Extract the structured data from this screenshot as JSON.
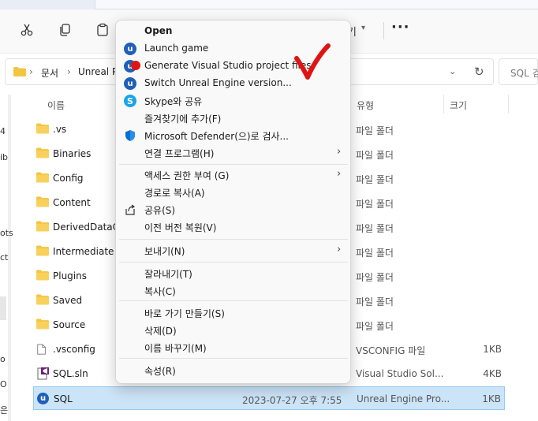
{
  "toolbar": {
    "items": [
      {
        "name": "cut-icon"
      },
      {
        "name": "copy-icon"
      },
      {
        "name": "paste-icon"
      }
    ],
    "view_label_fragment": "기",
    "more_label": "···"
  },
  "address": {
    "crumbs": [
      "문서",
      "Unreal P"
    ],
    "search_placeholder": "SQL 검"
  },
  "nav_fragments": [
    "4",
    "ib",
    "ots",
    "ct",
    "o",
    "O",
    "은"
  ],
  "file_list": {
    "columns": {
      "name": "이름",
      "type": "유형",
      "size": "크기"
    },
    "rows": [
      {
        "name": ".vs",
        "date": "",
        "type": "파일 폴더",
        "size": "",
        "icon": "folder-icon"
      },
      {
        "name": "Binaries",
        "date": "",
        "type": "파일 폴더",
        "size": "",
        "icon": "folder-icon"
      },
      {
        "name": "Config",
        "date": "",
        "type": "파일 폴더",
        "size": "",
        "icon": "folder-icon"
      },
      {
        "name": "Content",
        "date": "",
        "type": "파일 폴더",
        "size": "",
        "icon": "folder-icon"
      },
      {
        "name": "DerivedDataCa",
        "date": "",
        "type": "파일 폴더",
        "size": "",
        "icon": "folder-icon"
      },
      {
        "name": "Intermediate",
        "date": "",
        "type": "파일 폴더",
        "size": "",
        "icon": "folder-icon"
      },
      {
        "name": "Plugins",
        "date": "",
        "type": "파일 폴더",
        "size": "",
        "icon": "folder-icon"
      },
      {
        "name": "Saved",
        "date": "",
        "type": "파일 폴더",
        "size": "",
        "icon": "folder-icon"
      },
      {
        "name": "Source",
        "date": "",
        "type": "파일 폴더",
        "size": "",
        "icon": "folder-icon"
      },
      {
        "name": ".vsconfig",
        "date": "",
        "type": "VSCONFIG 파일",
        "size": "1KB",
        "icon": "file-icon"
      },
      {
        "name": "SQL.sln",
        "date": "",
        "type": "Visual Studio Sol...",
        "size": "4KB",
        "icon": "vs-solution-icon"
      },
      {
        "name": "SQL",
        "date": "2023-07-27 오후 7:55",
        "type": "Unreal Engine Pro...",
        "size": "1KB",
        "icon": "unreal-engine-icon",
        "selected": true
      }
    ]
  },
  "context_menu": {
    "items": [
      {
        "label": "Open",
        "bold": true,
        "icon": "none"
      },
      {
        "label": "Launch game",
        "icon": "unreal-engine-icon"
      },
      {
        "label": "Generate Visual Studio project files",
        "icon": "unreal-engine-icon"
      },
      {
        "label": "Switch Unreal Engine version...",
        "icon": "unreal-engine-icon"
      },
      {
        "label": "Skype와 공유",
        "icon": "skype-icon"
      },
      {
        "label": "즐겨찾기에 추가(F)",
        "icon": "none"
      },
      {
        "label": "Microsoft Defender(으)로 검사...",
        "icon": "defender-shield-icon"
      },
      {
        "label": "연결 프로그램(H)",
        "icon": "none",
        "submenu": true
      },
      {
        "label": "액세스 권한 부여 (G)",
        "icon": "none",
        "submenu": true
      },
      {
        "label": "경로로 복사(A)",
        "icon": "none"
      },
      {
        "label": "공유(S)",
        "icon": "share-icon"
      },
      {
        "label": "이전 버전 복원(V)",
        "icon": "none"
      },
      {
        "label": "보내기(N)",
        "icon": "none",
        "submenu": true
      },
      {
        "label": "잘라내기(T)",
        "icon": "none"
      },
      {
        "label": "복사(C)",
        "icon": "none"
      },
      {
        "label": "바로 가기 만들기(S)",
        "icon": "none"
      },
      {
        "label": "삭제(D)",
        "icon": "none"
      },
      {
        "label": "이름 바꾸기(M)",
        "icon": "none"
      },
      {
        "label": "속성(R)",
        "icon": "none"
      }
    ],
    "submenu_arrow": "›"
  },
  "colors": {
    "selection": "#cce4f7",
    "folder": "#f4c542",
    "unreal": "#1f5fb8",
    "annotation_red": "#e01414"
  }
}
